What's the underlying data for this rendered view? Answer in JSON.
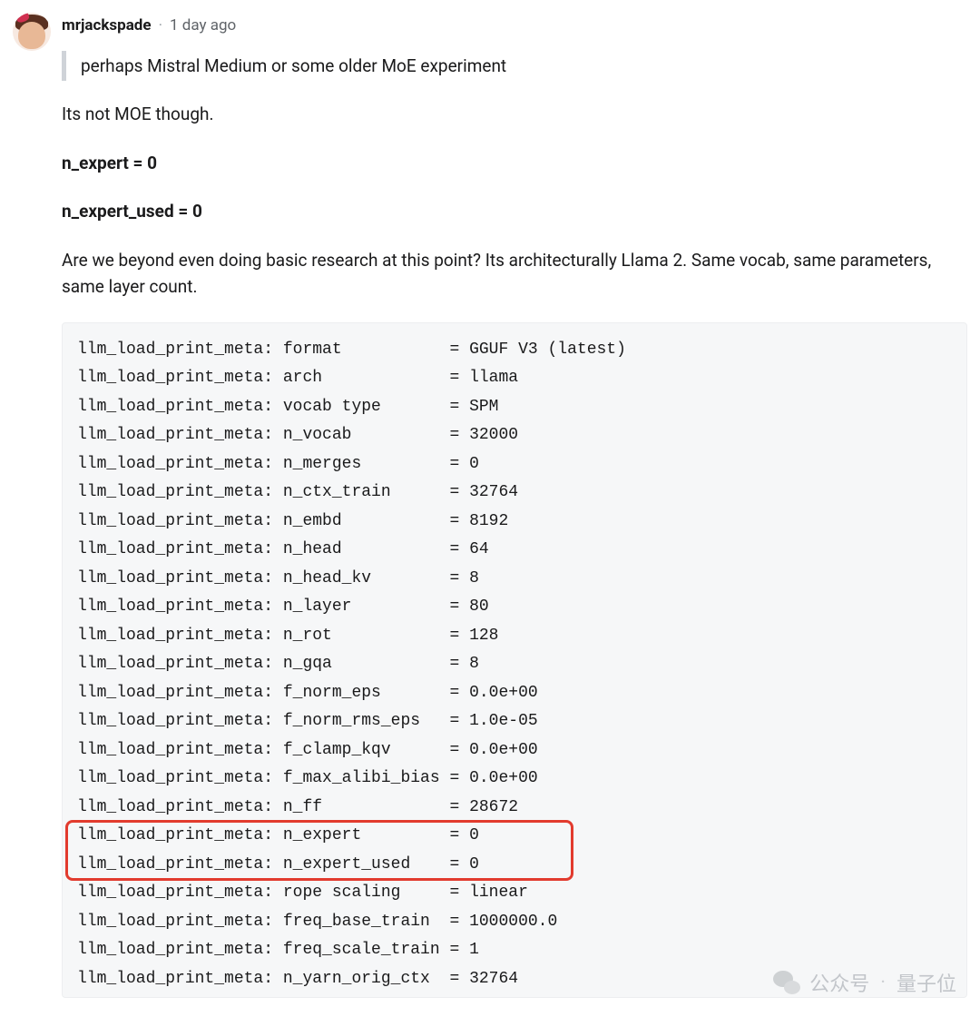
{
  "comment": {
    "username": "mrjackspade",
    "separator": "·",
    "time": "1 day ago",
    "quote": "perhaps Mistral Medium or some older MoE experiment",
    "line1": "Its not MOE though.",
    "bold1": "n_expert = 0",
    "bold2": "n_expert_used = 0",
    "line2": "Are we beyond even doing basic research at this point? Its architecturally Llama 2. Same vocab, same parameters, same layer count."
  },
  "code": {
    "prefix": "llm_load_print_meta:",
    "rows": [
      {
        "key": "format",
        "value": "GGUF V3 (latest)",
        "hl": false
      },
      {
        "key": "arch",
        "value": "llama",
        "hl": false
      },
      {
        "key": "vocab type",
        "value": "SPM",
        "hl": false
      },
      {
        "key": "n_vocab",
        "value": "32000",
        "hl": false
      },
      {
        "key": "n_merges",
        "value": "0",
        "hl": false
      },
      {
        "key": "n_ctx_train",
        "value": "32764",
        "hl": false
      },
      {
        "key": "n_embd",
        "value": "8192",
        "hl": false
      },
      {
        "key": "n_head",
        "value": "64",
        "hl": false
      },
      {
        "key": "n_head_kv",
        "value": "8",
        "hl": false
      },
      {
        "key": "n_layer",
        "value": "80",
        "hl": false
      },
      {
        "key": "n_rot",
        "value": "128",
        "hl": false
      },
      {
        "key": "n_gqa",
        "value": "8",
        "hl": false
      },
      {
        "key": "f_norm_eps",
        "value": "0.0e+00",
        "hl": false
      },
      {
        "key": "f_norm_rms_eps",
        "value": "1.0e-05",
        "hl": false
      },
      {
        "key": "f_clamp_kqv",
        "value": "0.0e+00",
        "hl": false
      },
      {
        "key": "f_max_alibi_bias",
        "value": "0.0e+00",
        "hl": false
      },
      {
        "key": "n_ff",
        "value": "28672",
        "hl": false
      },
      {
        "key": "n_expert",
        "value": "0",
        "hl": true
      },
      {
        "key": "n_expert_used",
        "value": "0",
        "hl": true
      },
      {
        "key": "rope scaling",
        "value": "linear",
        "hl": false
      },
      {
        "key": "freq_base_train",
        "value": "1000000.0",
        "hl": false
      },
      {
        "key": "freq_scale_train",
        "value": "1",
        "hl": false
      },
      {
        "key": "n_yarn_orig_ctx",
        "value": "32764",
        "hl": false
      }
    ],
    "key_pad": 16
  },
  "watermark": {
    "label": "公众号",
    "dot": "·",
    "name": "量子位"
  }
}
